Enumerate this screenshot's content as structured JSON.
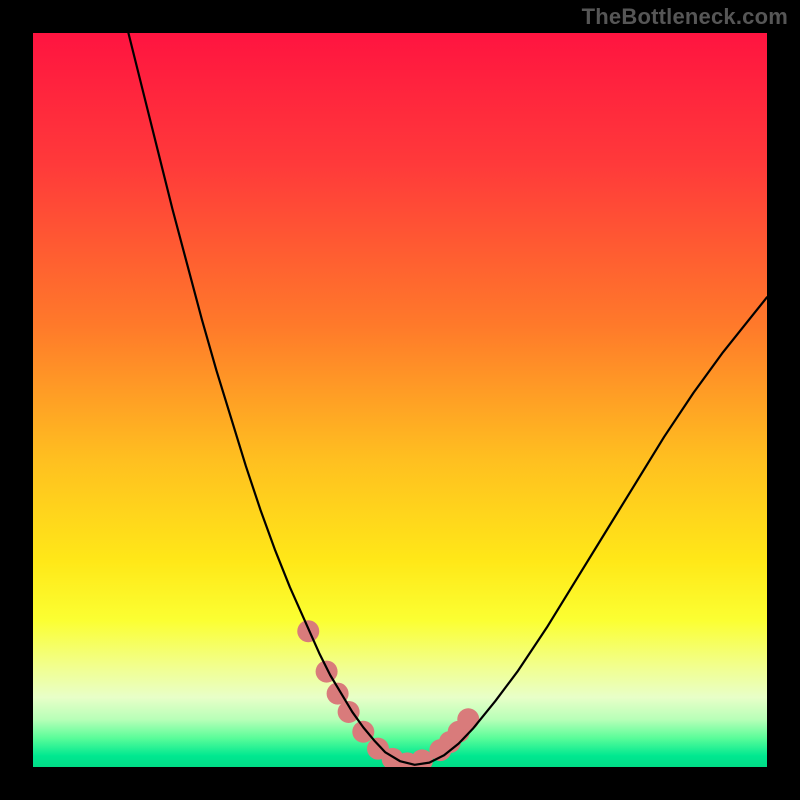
{
  "watermark": "TheBottleneck.com",
  "gradient": {
    "stops": [
      {
        "offset": 0.0,
        "color": "#ff1440"
      },
      {
        "offset": 0.18,
        "color": "#ff3a3a"
      },
      {
        "offset": 0.4,
        "color": "#ff7a2a"
      },
      {
        "offset": 0.58,
        "color": "#ffbf20"
      },
      {
        "offset": 0.72,
        "color": "#ffe818"
      },
      {
        "offset": 0.8,
        "color": "#fbff32"
      },
      {
        "offset": 0.86,
        "color": "#f2ff8a"
      },
      {
        "offset": 0.905,
        "color": "#e8ffc8"
      },
      {
        "offset": 0.935,
        "color": "#b8ffb8"
      },
      {
        "offset": 0.96,
        "color": "#5cfd9a"
      },
      {
        "offset": 0.985,
        "color": "#00e890"
      },
      {
        "offset": 1.0,
        "color": "#00dc86"
      }
    ]
  },
  "chart_data": {
    "type": "line",
    "title": "",
    "xlabel": "",
    "ylabel": "",
    "xlim": [
      0,
      100
    ],
    "ylim": [
      0,
      100
    ],
    "grid": false,
    "series": [
      {
        "name": "curve",
        "x": [
          13,
          15,
          17,
          19,
          21,
          23,
          25,
          27,
          29,
          31,
          33,
          35,
          37,
          39,
          40.5,
          42,
          43.5,
          45,
          46.5,
          48,
          50,
          52,
          54,
          56,
          58,
          60,
          63,
          66,
          70,
          74,
          78,
          82,
          86,
          90,
          94,
          98,
          100
        ],
        "values": [
          100,
          92,
          84,
          76,
          68.5,
          61,
          54,
          47.5,
          41,
          35,
          29.5,
          24.5,
          20,
          15.5,
          12.5,
          10,
          7.5,
          5.4,
          3.6,
          2,
          0.8,
          0.3,
          0.6,
          1.6,
          3.2,
          5.3,
          9,
          13,
          19,
          25.5,
          32,
          38.5,
          45,
          51,
          56.5,
          61.5,
          64
        ]
      },
      {
        "name": "markers",
        "x": [
          37.5,
          40,
          41.5,
          43,
          45,
          47,
          49,
          51,
          53,
          55.5,
          56.8,
          58,
          59.3
        ],
        "values": [
          18.5,
          13,
          10,
          7.5,
          4.8,
          2.5,
          1.1,
          0.5,
          0.9,
          2.3,
          3.4,
          4.8,
          6.5
        ]
      }
    ]
  },
  "style": {
    "curve_color": "#000000",
    "curve_width": 2.2,
    "marker_color": "#d97b7b",
    "marker_radius": 11
  }
}
